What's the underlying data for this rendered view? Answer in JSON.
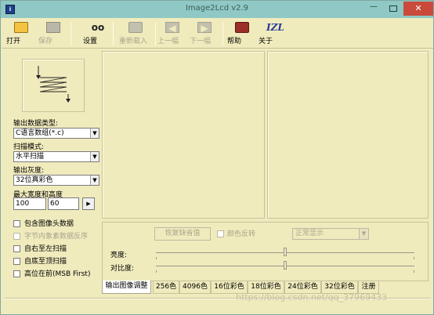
{
  "window": {
    "title": "Image2Lcd v2.9"
  },
  "colors": {
    "window_bg": "#f0ebbd",
    "titlebar_bg": "#8fc8c4",
    "close_bg": "#c94a3a",
    "disabled_text": "#a9a58b"
  },
  "toolbar": {
    "open": {
      "label": "打开",
      "icon": "open-folder-icon"
    },
    "save": {
      "label": "保存",
      "icon": "save-disk-icon"
    },
    "settings": {
      "label": "设置",
      "icon": "settings-glasses-icon"
    },
    "reload": {
      "label": "重新载入",
      "icon": "reload-icon"
    },
    "prev": {
      "label": "上一幅",
      "icon": "previous-image-icon"
    },
    "next": {
      "label": "下一幅",
      "icon": "next-image-icon"
    },
    "help": {
      "label": "帮助",
      "icon": "help-book-icon"
    },
    "about": {
      "label": "关于",
      "icon": "about-izl-icon",
      "glyph": "IZL"
    }
  },
  "left_panel": {
    "output_type_label": "输出数据类型:",
    "output_type_value": "C语言数组(*.c)",
    "scan_mode_label": "扫描模式:",
    "scan_mode_value": "水平扫描",
    "output_gray_label": "输出灰度:",
    "output_gray_value": "32位真彩色",
    "max_size_label": "最大宽度和高度",
    "max_width": "100",
    "max_height": "60",
    "checkboxes": [
      {
        "label": "包含图像头数据",
        "checked": false,
        "enabled": true
      },
      {
        "label": "字节内象素数据反序",
        "checked": false,
        "enabled": false
      },
      {
        "label": "自右至左扫描",
        "checked": false,
        "enabled": true
      },
      {
        "label": "自底至顶扫描",
        "checked": false,
        "enabled": true
      },
      {
        "label": "高位在前(MSB First)",
        "checked": false,
        "enabled": true
      }
    ]
  },
  "adjust_panel": {
    "reset_button": "恢复缺省值",
    "invert_label": "颜色反转",
    "display_mode": "正常显示",
    "brightness_label": "亮度:",
    "contrast_label": "对比度:",
    "brightness_value": 0.5,
    "contrast_value": 0.5
  },
  "tabs": [
    "输出图像调整",
    "256色",
    "4096色",
    "16位彩色",
    "18位彩色",
    "24位彩色",
    "32位彩色",
    "注册"
  ],
  "active_tab": 0,
  "watermark": "https://blog.csdn.net/qq_37969433"
}
